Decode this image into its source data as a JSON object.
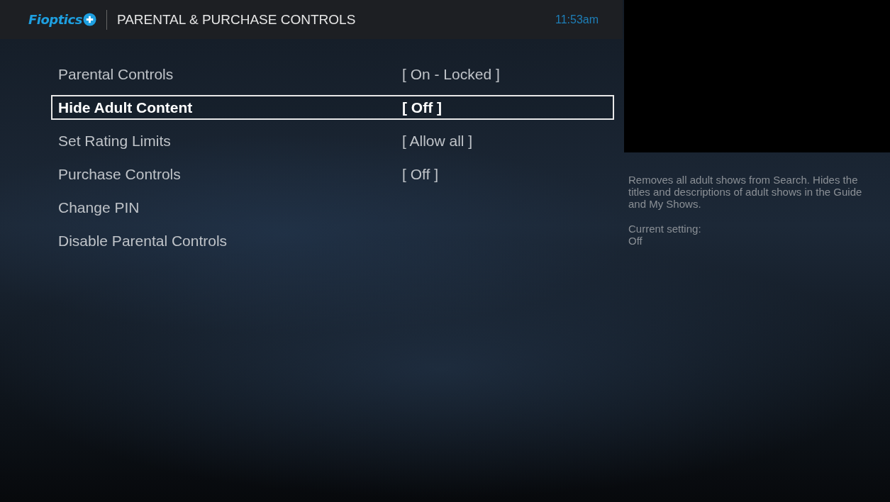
{
  "header": {
    "logo": "Fioptics",
    "title": "PARENTAL & PURCHASE CONTROLS",
    "time": "11:53am"
  },
  "menu": [
    {
      "label": "Parental Controls",
      "value": "[ On - Locked ]",
      "selected": false
    },
    {
      "label": "Hide Adult Content",
      "value": "[ Off ]",
      "selected": true
    },
    {
      "label": "Set Rating Limits",
      "value": "[ Allow all ]",
      "selected": false
    },
    {
      "label": "Purchase Controls",
      "value": "[ Off ]",
      "selected": false
    },
    {
      "label": "Change PIN",
      "selected": false
    },
    {
      "label": "Disable Parental Controls",
      "selected": false
    }
  ],
  "info": {
    "description": "Removes all adult shows from Search. Hides the titles and descriptions of adult shows in the Guide and My Shows.",
    "setting_label": "Current setting:",
    "setting_value": "Off"
  }
}
